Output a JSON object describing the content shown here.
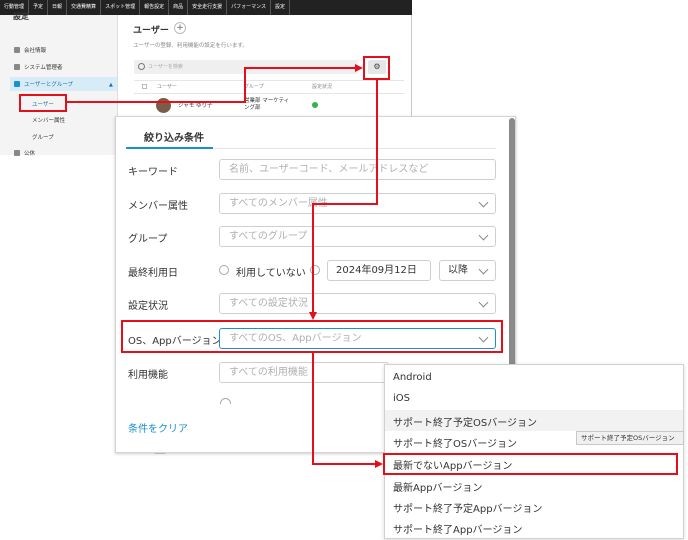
{
  "topnav": {
    "items": [
      "行動管理",
      "予定",
      "日報",
      "交通費精算",
      "スポット管理",
      "報告設定",
      "商品",
      "安全走行支援",
      "パフォーマンス",
      "設定"
    ]
  },
  "sidebar": {
    "title": "設定",
    "items": [
      {
        "label": "会社情報",
        "icon": "building-icon"
      },
      {
        "label": "システム管理者",
        "icon": "admin-icon"
      },
      {
        "label": "ユーザーとグループ",
        "icon": "users-icon"
      }
    ],
    "subitems": [
      "ユーザー",
      "メンバー属性",
      "グループ"
    ],
    "next_item": "公休"
  },
  "main": {
    "title": "ユーザー",
    "add_label": "+",
    "description": "ユーザーの登録、利用機能の設定を行います。",
    "search_placeholder": "ユーザーを検索",
    "columns": [
      "ユーザー",
      "グループ",
      "設定状況"
    ],
    "row": {
      "name": "ジャモ ゆり子",
      "group": "営業部 マーケティング部"
    }
  },
  "modal": {
    "tab": "絞り込み条件",
    "keyword": {
      "label": "キーワード",
      "placeholder": "名前、ユーザーコード、メールアドレスなど"
    },
    "member_attr": {
      "label": "メンバー属性",
      "placeholder": "すべてのメンバー属性"
    },
    "group": {
      "label": "グループ",
      "placeholder": "すべてのグループ"
    },
    "last_used": {
      "label": "最終利用日",
      "not_used": "利用していない",
      "date": "2024年09月12日",
      "since": "以降"
    },
    "setting_status": {
      "label": "設定状況",
      "placeholder": "すべての設定状況"
    },
    "os_version": {
      "label": "OS、Appバージョン",
      "placeholder": "すべてのOS、Appバージョン"
    },
    "features": {
      "label": "利用機能",
      "placeholder": "すべての利用機能"
    },
    "clear_label": "条件をクリア"
  },
  "dropdown": {
    "options": [
      "Android",
      "iOS",
      "サポート終了予定OSバージョン",
      "サポート終了OSバージョン",
      "最新でないAppバージョン",
      "最新Appバージョン",
      "サポート終了予定Appバージョン",
      "サポート終了Appバージョン"
    ],
    "highlighted_index": 2,
    "selected_index": 4,
    "tooltip": "サポート終了予定OSバージョン"
  },
  "colors": {
    "annotation": "#e3101a",
    "accent": "#1a8fd1",
    "status_ok": "#34b34a"
  }
}
